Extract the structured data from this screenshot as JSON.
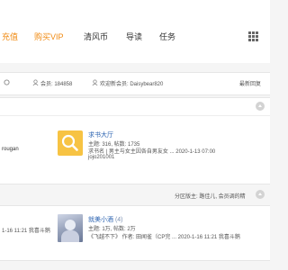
{
  "topnav": {
    "items": [
      {
        "label": "充值",
        "highlight": true
      },
      {
        "label": "购买VIP",
        "highlight": true
      },
      {
        "label": "清风币",
        "highlight": false
      },
      {
        "label": "导读",
        "highlight": false
      },
      {
        "label": "任务",
        "highlight": false
      }
    ],
    "menu_icon": "grid-icon"
  },
  "stats": {
    "members_label": "会员: 184858",
    "welcome_label": "欢迎新会员: Daisybear820",
    "latest_label": "最新回复"
  },
  "forum1": {
    "left_user": "rougan",
    "title": "求书大厅",
    "stats": "主题: 316, 帖数: 1735",
    "last_post": "求书名 | 男主与女主因各自男友女 ... 2020-1-13 07:00",
    "last_user": "jojo201001",
    "icon": "search-icon"
  },
  "forum2": {
    "moderators": "分区版主: 路佳儿, 会员调的精",
    "left_time": "1-16 11:21 我喜斗鹅",
    "title": "就美小酒",
    "count": "(4)",
    "stats": "主题: 1万, 帖数: 2万",
    "last_post": "《飞越不下》 作者: 田闻雀（CP完 ... 2020-1-16 11:21 我喜斗鹅"
  },
  "colors": {
    "accent_orange": "#f08a12",
    "link_blue": "#2a62b0",
    "forum_icon_yellow": "#f7c343"
  }
}
